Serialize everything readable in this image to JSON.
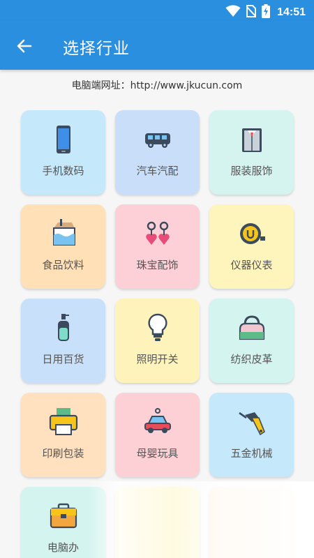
{
  "status_bar": {
    "time": "14:51",
    "icons": [
      "wifi-icon",
      "no-sim-icon",
      "battery-charging-icon"
    ]
  },
  "header": {
    "title": "选择行业",
    "back_icon": "arrow-left-icon",
    "color": "#2b8fe0"
  },
  "pc_url": "电脑端网址：http://www.jkucun.com",
  "industries": [
    {
      "label": "手机数码",
      "icon": "smartphone-icon",
      "bg": "#c5e9fb"
    },
    {
      "label": "汽车汽配",
      "icon": "bus-icon",
      "bg": "#c8def9"
    },
    {
      "label": "服装服饰",
      "icon": "shirt-icon",
      "bg": "#d5f3ef"
    },
    {
      "label": "食品饮料",
      "icon": "milk-carton-icon",
      "bg": "#ffe0b7"
    },
    {
      "label": "珠宝配饰",
      "icon": "earrings-icon",
      "bg": "#fdcfd6"
    },
    {
      "label": "仪器仪表",
      "icon": "tape-measure-icon",
      "bg": "#fef5bd"
    },
    {
      "label": "日用百货",
      "icon": "soap-bottle-icon",
      "bg": "#c9e0fa"
    },
    {
      "label": "照明开关",
      "icon": "light-bulb-icon",
      "bg": "#fef4bb"
    },
    {
      "label": "纺织皮革",
      "icon": "handbag-icon",
      "bg": "#d4f4ef"
    },
    {
      "label": "印刷包装",
      "icon": "printer-icon",
      "bg": "#ffe1bf"
    },
    {
      "label": "母婴玩具",
      "icon": "toy-car-icon",
      "bg": "#fdd0d6"
    },
    {
      "label": "五金机械",
      "icon": "drill-icon",
      "bg": "#c5e8fb"
    },
    {
      "label": "电脑办公",
      "icon": "briefcase-icon",
      "bg": "#d4f4ef"
    },
    {
      "label": "",
      "icon": "",
      "bg": "#fef5bd"
    },
    {
      "label": "",
      "icon": "",
      "bg": "#ffe3c4"
    }
  ],
  "visible_partial_label": "电脑办"
}
